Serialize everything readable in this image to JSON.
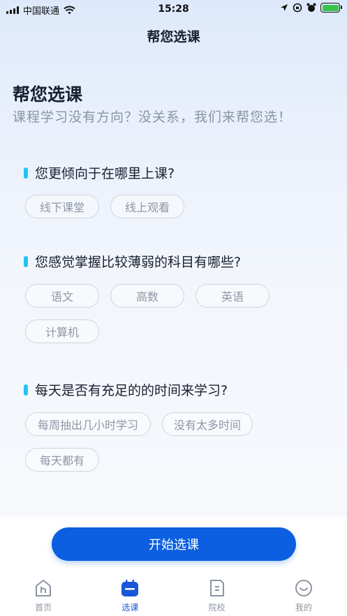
{
  "status_bar": {
    "carrier": "中国联通",
    "time": "15:28"
  },
  "nav": {
    "title": "帮您选课"
  },
  "hero": {
    "title": "帮您选课",
    "subtitle": "课程学习没有方向？没关系，我们来帮您选！"
  },
  "questions": [
    {
      "text": "您更倾向于在哪里上课?",
      "options": [
        "线下课堂",
        "线上观看"
      ]
    },
    {
      "text": "您感觉掌握比较薄弱的科目有哪些?",
      "options": [
        "语文",
        "高数",
        "英语",
        "计算机"
      ]
    },
    {
      "text": "每天是否有充足的的时间来学习?",
      "options": [
        "每周抽出几小时学习",
        "没有太多时间",
        "每天都有"
      ]
    }
  ],
  "start_button": {
    "label": "开始选课"
  },
  "tabbar": {
    "items": [
      {
        "label": "首页",
        "icon": "home-icon",
        "active": false
      },
      {
        "label": "选课",
        "icon": "calendar-icon",
        "active": true
      },
      {
        "label": "院校",
        "icon": "school-icon",
        "active": false
      },
      {
        "label": "我的",
        "icon": "smile-icon",
        "active": false
      }
    ]
  },
  "colors": {
    "primary": "#0b5fe0",
    "accent": "#1fc6f2",
    "tab_active": "#1a56d9",
    "tab_inactive": "#8d94a1"
  }
}
